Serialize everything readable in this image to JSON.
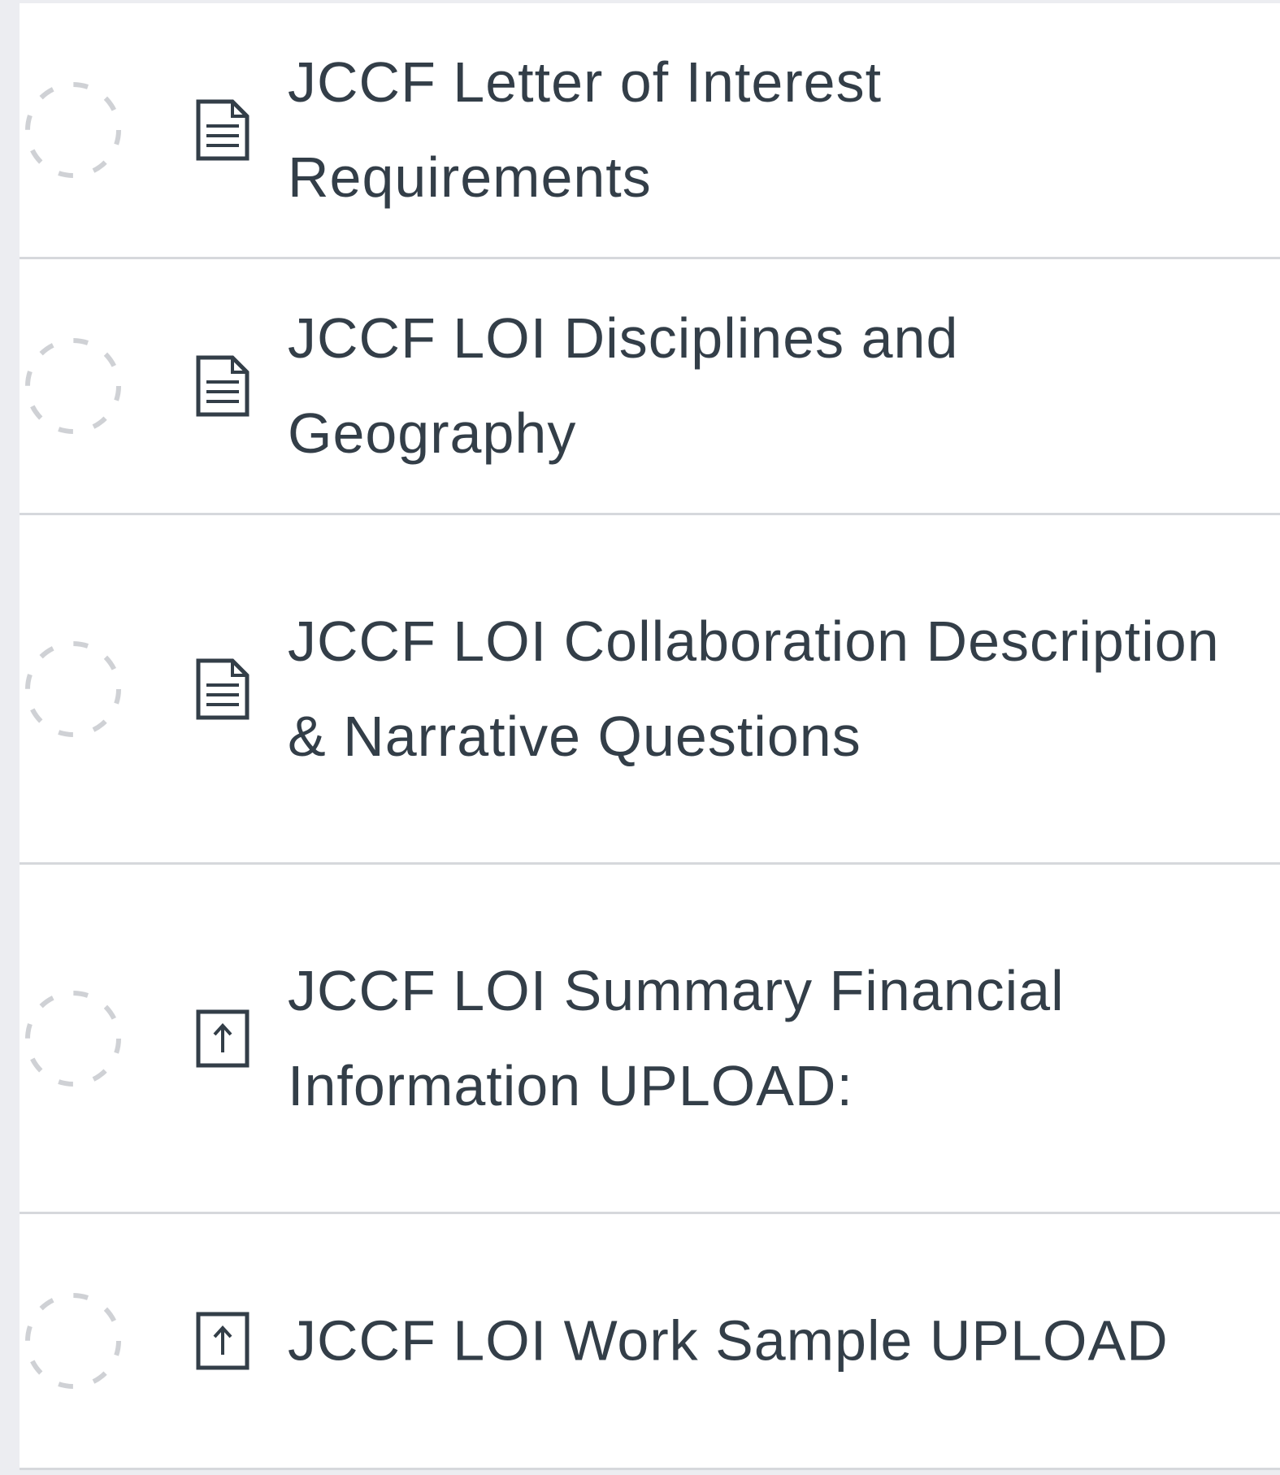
{
  "tasks": [
    {
      "title": "JCCF Letter of Interest Requirements",
      "type": "document",
      "icon": "document-icon",
      "status": "incomplete"
    },
    {
      "title": "JCCF LOI Disciplines and Geography",
      "type": "document",
      "icon": "document-icon",
      "status": "incomplete"
    },
    {
      "title": "JCCF LOI Collaboration Description & Narrative Questions",
      "type": "document",
      "icon": "document-icon",
      "status": "incomplete"
    },
    {
      "title": "JCCF LOI Summary Financial Information UPLOAD:",
      "type": "upload",
      "icon": "upload-icon",
      "status": "incomplete"
    },
    {
      "title": "JCCF LOI Work Sample UPLOAD",
      "type": "upload",
      "icon": "upload-icon",
      "status": "incomplete"
    }
  ],
  "colors": {
    "page_background": "#ecedf1",
    "card_background": "#ffffff",
    "divider": "#d6d8dc",
    "text": "#333e48",
    "status_ring": "#cfd1d5"
  }
}
